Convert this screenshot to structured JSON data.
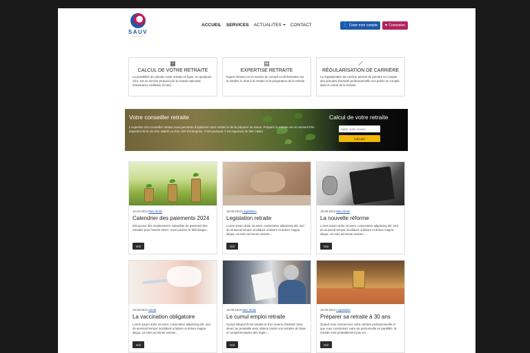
{
  "nav": {
    "logo_text": "SAUV",
    "logo_sub": "assurance retraite",
    "items": [
      "ACCUEIL",
      "SERVICES",
      "ACTUALITES",
      "CONTACT"
    ],
    "create_account": "Créer mon compte",
    "login": "Connexion"
  },
  "services": [
    {
      "icon": "calculator-icon",
      "title": "CALCUL DE VOTRE RETRAITE",
      "text": "La possibilité de calculer votre retraite en ligne, en quelques clics, est un service proposé par la Caisse nationale d'assurance vieillesse (Cnav)."
    },
    {
      "icon": "calendar-icon",
      "title": "EXPERTISE RETRAITE",
      "text": "Expert retraite est un service de conseil et d'information sur la retraite, le droit à la retraite et la préparation de la retraite."
    },
    {
      "icon": "chart-icon",
      "title": "RÉGULARISATION DE CARRIÈRE",
      "text": "La régularisation de carrière permet de prendre en compte des périodes d'activité professionnelle non prises en compte dans le calcul de la retraite."
    }
  ],
  "banner": {
    "title": "Votre conseiller retraite",
    "text": "L'expertise d'un conseiller retraite vous permettra d'optimiser votre retraite et de la préparer au mieux. Préparer la retraite est un moment très important de la vie d'un salarié ou d'un chef d'entreprise. C'est pourquoi, il est important de bien l'aider.",
    "calc_title": "Calcul de votre retraite",
    "input_placeholder": "Saisir votre revenu",
    "calc_button": "Calculez"
  },
  "cards": [
    {
      "date": "12-02-2024",
      "category": "Mes droits",
      "title": "Calendrier des paiements 2024",
      "text": "Découvrez dès maintenant le calendrier de paiement des retraites pour l'année 2024 ! Vous pourrez le télécharger...",
      "button": "Voir"
    },
    {
      "date": "18-09-2023",
      "category": "Legislation",
      "title": "Legislation retraite",
      "text": "Lorem ipsum dolor sit amet, consectetur adipiscing elit, sed do eiusmod tempor incididunt ut labore et dolore magna aliqua. Ut enim ad minim veniam...",
      "button": "Voir"
    },
    {
      "date": "18-09-2023",
      "category": "Mes droits",
      "title": "La nouvelle réforme",
      "text": "Lorem ipsum dolor sit amet, consectetur adipiscing elit, sed do eiusmod tempor incididunt ut labore et dolore magna aliqua. Ut enim ad minim veniam...",
      "button": "Voir"
    },
    {
      "date": "18-09-2023",
      "category": "Santé",
      "title": "La vaccination obligatoire",
      "text": "Lorem ipsum dolor sit amet, consectetur adipiscing elit, sed do eiusmod tempor incididunt ut labore et dolore magna aliqua. Ut enim ad minim veniam...",
      "button": "Voir"
    },
    {
      "date": "18-09-2023",
      "category": "Mes droits",
      "title": "Le cumul emploi retraite",
      "text": "Cumul intégral d'une retraite et d'un revenu d'activité Vous devez au préalable avoir obtenu toutes vos retraites de base et complémentaires des régim...",
      "button": "Voir"
    },
    {
      "date": "18-09-2023",
      "category": "Legislation",
      "title": "Préparer sa retraite à 30 ans",
      "text": "Quand vous commencez votre carrière professionnelle et que vous construisez votre vie personnelle en parallèle, la retraite n'est probablement pas ver...",
      "button": "Voir"
    }
  ]
}
